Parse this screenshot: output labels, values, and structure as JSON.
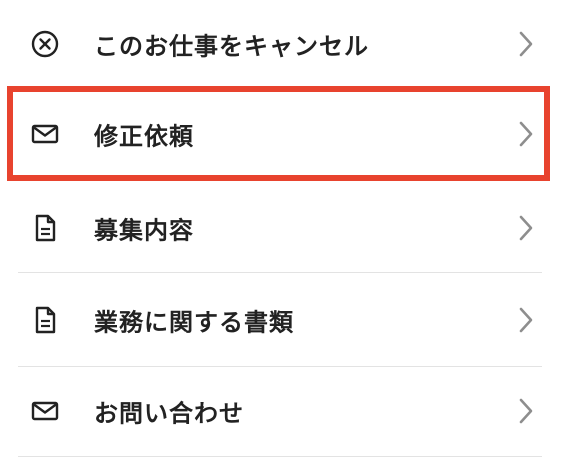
{
  "menu": {
    "items": [
      {
        "label": "このお仕事をキャンセル",
        "icon": "cancel-circle-icon"
      },
      {
        "label": "修正依頼",
        "icon": "mail-icon"
      },
      {
        "label": "募集内容",
        "icon": "document-icon"
      },
      {
        "label": "業務に関する書類",
        "icon": "document-icon"
      },
      {
        "label": "お問い合わせ",
        "icon": "mail-icon"
      }
    ],
    "chevron_icon": "chevron-right-icon"
  },
  "colors": {
    "text": "#222222",
    "chevron": "#8e8e8e",
    "divider": "#e3e3e3",
    "highlight": "#e8432e"
  }
}
